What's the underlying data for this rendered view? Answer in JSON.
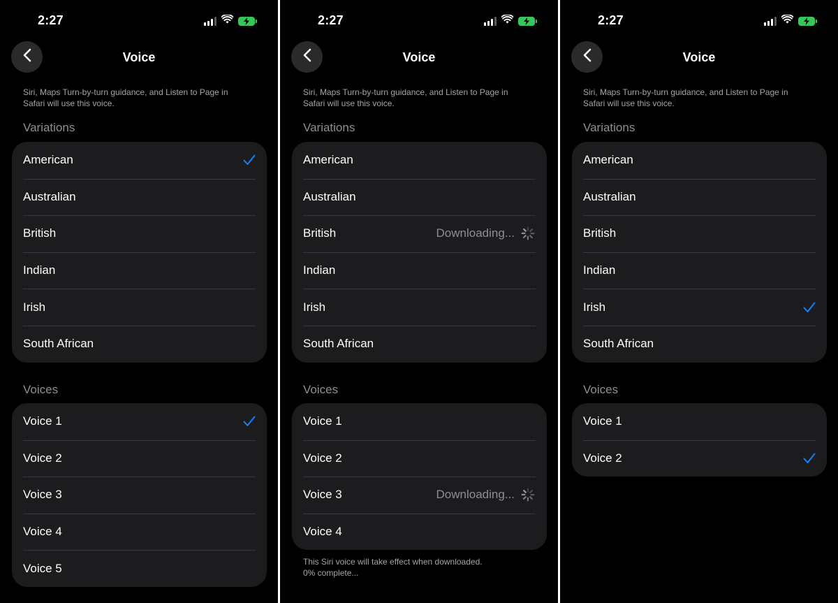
{
  "colors": {
    "accent": "#0a84ff",
    "background": "#000000",
    "group": "#1c1c1e",
    "battery": "#34c759"
  },
  "panels": [
    {
      "time": "2:27",
      "title": "Voice",
      "description": "Siri, Maps Turn-by-turn guidance, and Listen to Page in Safari will use this voice.",
      "variations_header": "Variations",
      "variations": [
        {
          "label": "American",
          "checked": true,
          "status": ""
        },
        {
          "label": "Australian",
          "checked": false,
          "status": ""
        },
        {
          "label": "British",
          "checked": false,
          "status": ""
        },
        {
          "label": "Indian",
          "checked": false,
          "status": ""
        },
        {
          "label": "Irish",
          "checked": false,
          "status": ""
        },
        {
          "label": "South African",
          "checked": false,
          "status": ""
        }
      ],
      "voices_header": "Voices",
      "voices": [
        {
          "label": "Voice 1",
          "checked": true,
          "status": ""
        },
        {
          "label": "Voice 2",
          "checked": false,
          "status": ""
        },
        {
          "label": "Voice 3",
          "checked": false,
          "status": ""
        },
        {
          "label": "Voice 4",
          "checked": false,
          "status": ""
        },
        {
          "label": "Voice 5",
          "checked": false,
          "status": ""
        }
      ],
      "footer": ""
    },
    {
      "time": "2:27",
      "title": "Voice",
      "description": "Siri, Maps Turn-by-turn guidance, and Listen to Page in Safari will use this voice.",
      "variations_header": "Variations",
      "variations": [
        {
          "label": "American",
          "checked": false,
          "status": ""
        },
        {
          "label": "Australian",
          "checked": false,
          "status": ""
        },
        {
          "label": "British",
          "checked": false,
          "status": "Downloading..."
        },
        {
          "label": "Indian",
          "checked": false,
          "status": ""
        },
        {
          "label": "Irish",
          "checked": false,
          "status": ""
        },
        {
          "label": "South African",
          "checked": false,
          "status": ""
        }
      ],
      "voices_header": "Voices",
      "voices": [
        {
          "label": "Voice 1",
          "checked": false,
          "status": ""
        },
        {
          "label": "Voice 2",
          "checked": false,
          "status": ""
        },
        {
          "label": "Voice 3",
          "checked": false,
          "status": "Downloading..."
        },
        {
          "label": "Voice 4",
          "checked": false,
          "status": ""
        }
      ],
      "footer_line1": "This Siri voice will take effect when downloaded.",
      "footer_line2": "0% complete..."
    },
    {
      "time": "2:27",
      "title": "Voice",
      "description": "Siri, Maps Turn-by-turn guidance, and Listen to Page in Safari will use this voice.",
      "variations_header": "Variations",
      "variations": [
        {
          "label": "American",
          "checked": false,
          "status": ""
        },
        {
          "label": "Australian",
          "checked": false,
          "status": ""
        },
        {
          "label": "British",
          "checked": false,
          "status": ""
        },
        {
          "label": "Indian",
          "checked": false,
          "status": ""
        },
        {
          "label": "Irish",
          "checked": true,
          "status": ""
        },
        {
          "label": "South African",
          "checked": false,
          "status": ""
        }
      ],
      "voices_header": "Voices",
      "voices": [
        {
          "label": "Voice 1",
          "checked": false,
          "status": ""
        },
        {
          "label": "Voice 2",
          "checked": true,
          "status": ""
        }
      ],
      "footer": ""
    }
  ]
}
